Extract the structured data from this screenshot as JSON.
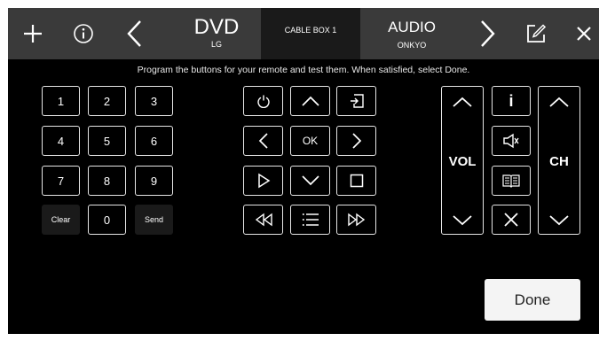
{
  "toolbar": {
    "add_icon": "plus-icon",
    "info_icon": "info-circle-icon",
    "prev_icon": "chevron-left-icon",
    "next_icon": "chevron-right-icon",
    "edit_icon": "edit-icon",
    "close_icon": "close-icon"
  },
  "tabs": [
    {
      "title": "DVD",
      "subtitle": "LG",
      "active": false
    },
    {
      "title": "CABLE BOX 1",
      "subtitle": "",
      "active": true
    },
    {
      "title": "AUDIO",
      "subtitle": "ONKYO",
      "active": false
    }
  ],
  "instructions": "Program the buttons for your remote and test them. When satisfied, select Done.",
  "keypad": {
    "keys": [
      "1",
      "2",
      "3",
      "4",
      "5",
      "6",
      "7",
      "8",
      "9",
      "Clear",
      "0",
      "Send"
    ]
  },
  "navigation": {
    "ok_label": "OK",
    "icons": [
      "power-icon",
      "arrow-up-icon",
      "input-icon",
      "arrow-left-icon",
      "arrow-right-icon",
      "play-icon",
      "arrow-down-icon",
      "stop-icon",
      "rewind-icon",
      "menu-icon",
      "fast-forward-icon"
    ]
  },
  "volume": {
    "label": "VOL"
  },
  "channel": {
    "label": "CH"
  },
  "middle_column": {
    "info_label": "i",
    "icons": [
      "mute-icon",
      "guide-icon",
      "exit-icon"
    ]
  },
  "done_label": "Done"
}
